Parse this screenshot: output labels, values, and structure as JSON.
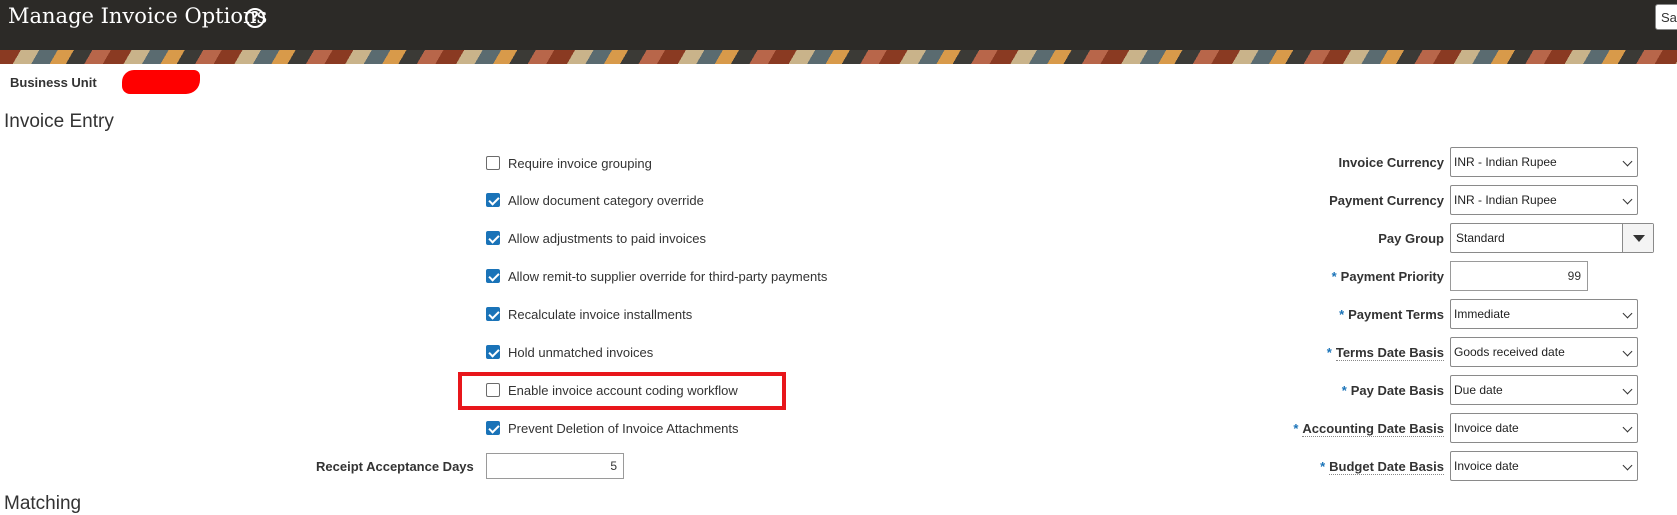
{
  "header": {
    "title": "Manage Invoice Options",
    "help_icon": "?",
    "save_label": "Save"
  },
  "business_unit": {
    "label": "Business Unit"
  },
  "sections": {
    "invoice_entry": "Invoice Entry",
    "matching": "Matching"
  },
  "checkboxes": [
    {
      "label": "Require invoice grouping",
      "checked": false
    },
    {
      "label": "Allow document category override",
      "checked": true
    },
    {
      "label": "Allow adjustments to paid invoices",
      "checked": true
    },
    {
      "label": "Allow remit-to supplier override for third-party payments",
      "checked": true
    },
    {
      "label": "Recalculate invoice installments",
      "checked": true
    },
    {
      "label": "Hold unmatched invoices",
      "checked": true
    },
    {
      "label": "Enable invoice account coding workflow",
      "checked": false
    },
    {
      "label": "Prevent Deletion of Invoice Attachments",
      "checked": true
    }
  ],
  "receipt_acceptance": {
    "label": "Receipt Acceptance Days",
    "value": "5"
  },
  "right_fields": {
    "invoice_currency": {
      "label": "Invoice Currency",
      "value": "INR - Indian Rupee"
    },
    "payment_currency": {
      "label": "Payment Currency",
      "value": "INR - Indian Rupee"
    },
    "pay_group": {
      "label": "Pay Group",
      "value": "Standard"
    },
    "payment_priority": {
      "label": "Payment Priority",
      "value": "99"
    },
    "payment_terms": {
      "label": "Payment Terms",
      "value": "Immediate"
    },
    "terms_date_basis": {
      "label": "Terms Date Basis",
      "value": "Goods received date"
    },
    "pay_date_basis": {
      "label": "Pay Date Basis",
      "value": "Due date"
    },
    "accounting_date_basis": {
      "label": "Accounting Date Basis",
      "value": "Invoice date"
    },
    "budget_date_basis": {
      "label": "Budget Date Basis",
      "value": "Invoice date"
    }
  },
  "required_marker": "*",
  "colors": {
    "header_bg": "#2c2a27",
    "highlight": "#e8161b",
    "checkbox_checked": "#1a73b8",
    "redaction": "#ff0000"
  }
}
